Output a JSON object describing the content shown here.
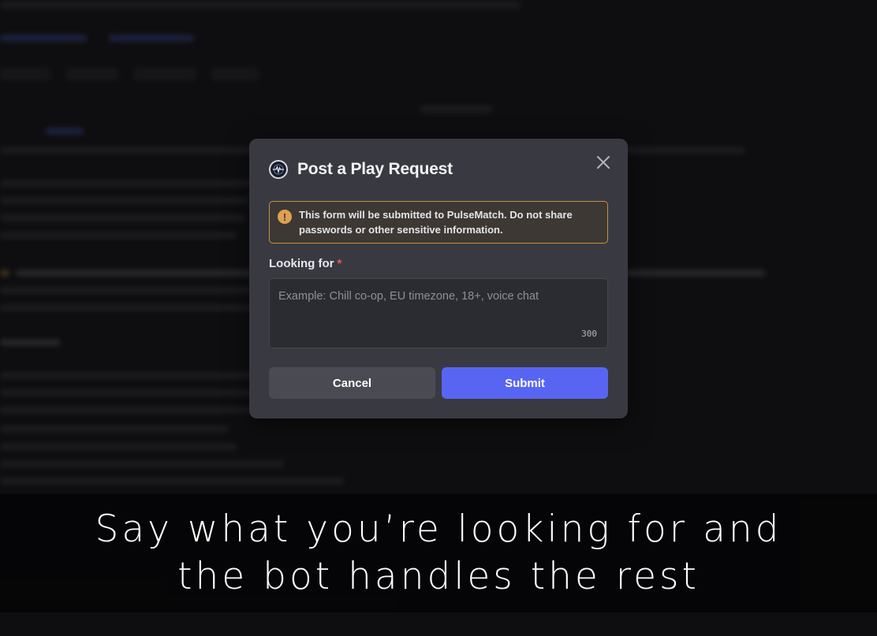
{
  "modal": {
    "title": "Post a Play Request",
    "warning": "This form will be submitted to PulseMatch. Do not share passwords or other sensitive information.",
    "field_label": "Looking for",
    "required_mark": "*",
    "placeholder": "Example: Chill co-op, EU timezone, 18+, voice chat",
    "char_counter": "300",
    "cancel_label": "Cancel",
    "submit_label": "Submit",
    "icons": {
      "app": "app-logo-icon",
      "close": "close-icon",
      "warning": "warning-icon"
    }
  },
  "caption": {
    "line1": "Say what you’re looking for and",
    "line2": "the bot handles the rest"
  },
  "colors": {
    "accent": "#5865f2",
    "warning_border": "#c98d4a",
    "required": "#f2555a"
  }
}
